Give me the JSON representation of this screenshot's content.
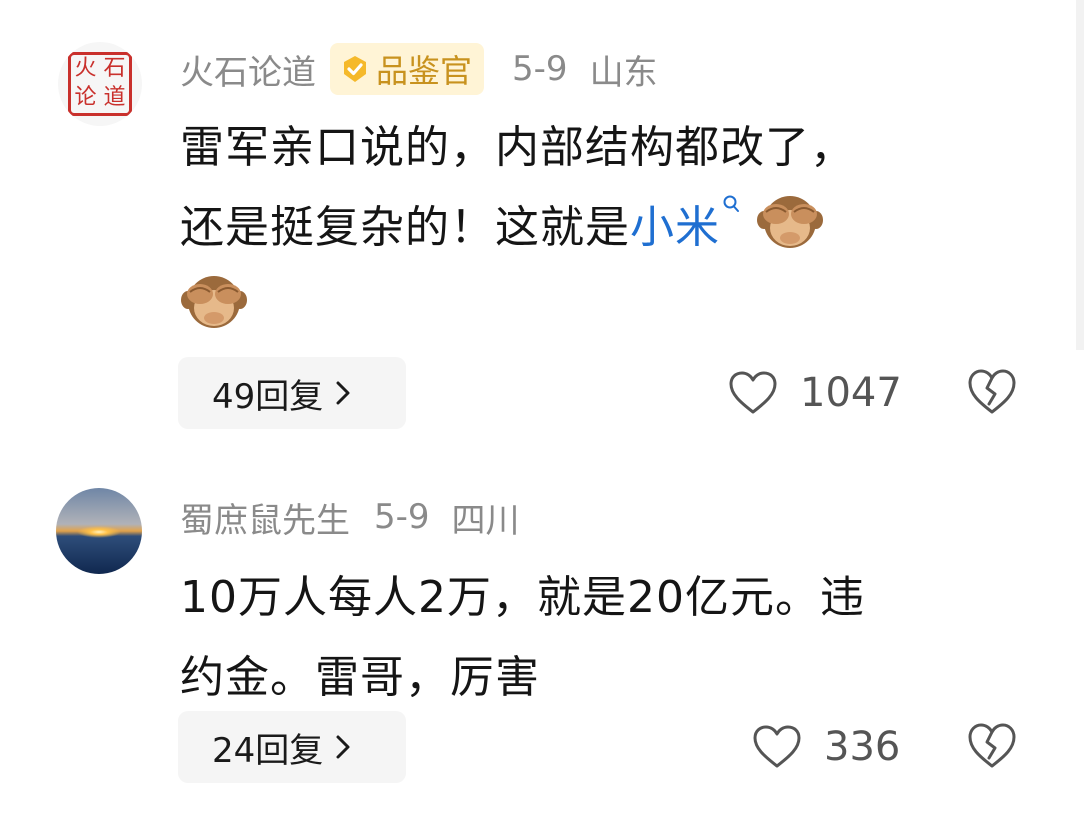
{
  "comments": [
    {
      "avatar_text": [
        "火",
        "石",
        "论",
        "道"
      ],
      "username": "火石论道",
      "badge": "品鉴官",
      "date": "5-9",
      "location": "山东",
      "text_line1": "雷军亲口说的，内部结构都改了，",
      "text_line2_prefix": "还是挺复杂的！这就是",
      "topic_link": "小米",
      "emoji": "see-no-evil-monkey",
      "reply_label": "49回复",
      "like_count": "1047"
    },
    {
      "username": "蜀庶鼠先生",
      "date": "5-9",
      "location": "四川",
      "text_line1": "10万人每人2万，就是20亿元。违",
      "text_line2": "约金。雷哥，厉害",
      "reply_label": "24回复",
      "like_count": "336"
    }
  ],
  "colors": {
    "meta_gray": "#8a8a8a",
    "link_blue": "#1f6fd1",
    "badge_bg": "#fff4d6",
    "badge_text": "#c8921e",
    "seal_red": "#c9302c"
  },
  "icons": [
    "heart-outline-icon",
    "broken-heart-icon",
    "chevron-right-icon",
    "search-icon",
    "badge-check-icon"
  ]
}
